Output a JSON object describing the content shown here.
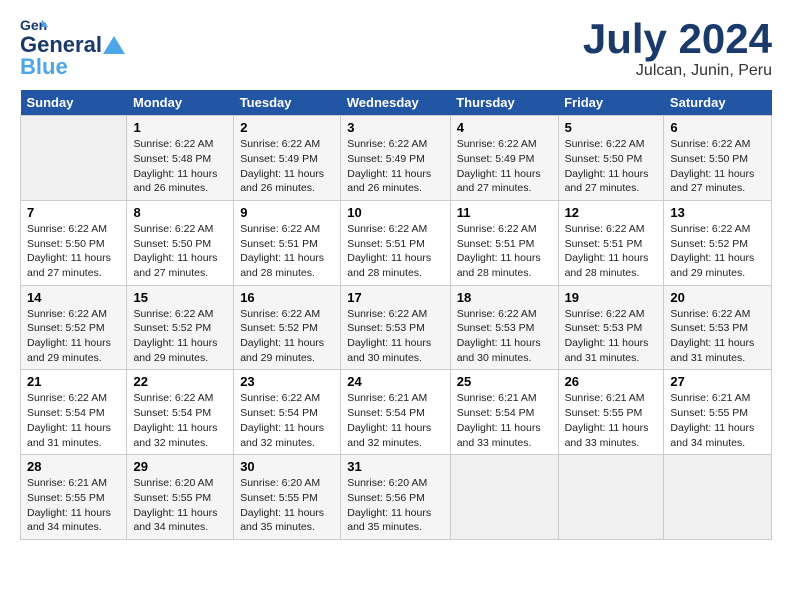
{
  "header": {
    "logo_general": "General",
    "logo_blue": "Blue",
    "title": "July 2024",
    "subtitle": "Julcan, Junin, Peru"
  },
  "calendar": {
    "days_of_week": [
      "Sunday",
      "Monday",
      "Tuesday",
      "Wednesday",
      "Thursday",
      "Friday",
      "Saturday"
    ],
    "weeks": [
      [
        {
          "day": "",
          "content": ""
        },
        {
          "day": "1",
          "content": "Sunrise: 6:22 AM\nSunset: 5:48 PM\nDaylight: 11 hours\nand 26 minutes."
        },
        {
          "day": "2",
          "content": "Sunrise: 6:22 AM\nSunset: 5:49 PM\nDaylight: 11 hours\nand 26 minutes."
        },
        {
          "day": "3",
          "content": "Sunrise: 6:22 AM\nSunset: 5:49 PM\nDaylight: 11 hours\nand 26 minutes."
        },
        {
          "day": "4",
          "content": "Sunrise: 6:22 AM\nSunset: 5:49 PM\nDaylight: 11 hours\nand 27 minutes."
        },
        {
          "day": "5",
          "content": "Sunrise: 6:22 AM\nSunset: 5:50 PM\nDaylight: 11 hours\nand 27 minutes."
        },
        {
          "day": "6",
          "content": "Sunrise: 6:22 AM\nSunset: 5:50 PM\nDaylight: 11 hours\nand 27 minutes."
        }
      ],
      [
        {
          "day": "7",
          "content": "Sunrise: 6:22 AM\nSunset: 5:50 PM\nDaylight: 11 hours\nand 27 minutes."
        },
        {
          "day": "8",
          "content": "Sunrise: 6:22 AM\nSunset: 5:50 PM\nDaylight: 11 hours\nand 27 minutes."
        },
        {
          "day": "9",
          "content": "Sunrise: 6:22 AM\nSunset: 5:51 PM\nDaylight: 11 hours\nand 28 minutes."
        },
        {
          "day": "10",
          "content": "Sunrise: 6:22 AM\nSunset: 5:51 PM\nDaylight: 11 hours\nand 28 minutes."
        },
        {
          "day": "11",
          "content": "Sunrise: 6:22 AM\nSunset: 5:51 PM\nDaylight: 11 hours\nand 28 minutes."
        },
        {
          "day": "12",
          "content": "Sunrise: 6:22 AM\nSunset: 5:51 PM\nDaylight: 11 hours\nand 28 minutes."
        },
        {
          "day": "13",
          "content": "Sunrise: 6:22 AM\nSunset: 5:52 PM\nDaylight: 11 hours\nand 29 minutes."
        }
      ],
      [
        {
          "day": "14",
          "content": "Sunrise: 6:22 AM\nSunset: 5:52 PM\nDaylight: 11 hours\nand 29 minutes."
        },
        {
          "day": "15",
          "content": "Sunrise: 6:22 AM\nSunset: 5:52 PM\nDaylight: 11 hours\nand 29 minutes."
        },
        {
          "day": "16",
          "content": "Sunrise: 6:22 AM\nSunset: 5:52 PM\nDaylight: 11 hours\nand 29 minutes."
        },
        {
          "day": "17",
          "content": "Sunrise: 6:22 AM\nSunset: 5:53 PM\nDaylight: 11 hours\nand 30 minutes."
        },
        {
          "day": "18",
          "content": "Sunrise: 6:22 AM\nSunset: 5:53 PM\nDaylight: 11 hours\nand 30 minutes."
        },
        {
          "day": "19",
          "content": "Sunrise: 6:22 AM\nSunset: 5:53 PM\nDaylight: 11 hours\nand 31 minutes."
        },
        {
          "day": "20",
          "content": "Sunrise: 6:22 AM\nSunset: 5:53 PM\nDaylight: 11 hours\nand 31 minutes."
        }
      ],
      [
        {
          "day": "21",
          "content": "Sunrise: 6:22 AM\nSunset: 5:54 PM\nDaylight: 11 hours\nand 31 minutes."
        },
        {
          "day": "22",
          "content": "Sunrise: 6:22 AM\nSunset: 5:54 PM\nDaylight: 11 hours\nand 32 minutes."
        },
        {
          "day": "23",
          "content": "Sunrise: 6:22 AM\nSunset: 5:54 PM\nDaylight: 11 hours\nand 32 minutes."
        },
        {
          "day": "24",
          "content": "Sunrise: 6:21 AM\nSunset: 5:54 PM\nDaylight: 11 hours\nand 32 minutes."
        },
        {
          "day": "25",
          "content": "Sunrise: 6:21 AM\nSunset: 5:54 PM\nDaylight: 11 hours\nand 33 minutes."
        },
        {
          "day": "26",
          "content": "Sunrise: 6:21 AM\nSunset: 5:55 PM\nDaylight: 11 hours\nand 33 minutes."
        },
        {
          "day": "27",
          "content": "Sunrise: 6:21 AM\nSunset: 5:55 PM\nDaylight: 11 hours\nand 34 minutes."
        }
      ],
      [
        {
          "day": "28",
          "content": "Sunrise: 6:21 AM\nSunset: 5:55 PM\nDaylight: 11 hours\nand 34 minutes."
        },
        {
          "day": "29",
          "content": "Sunrise: 6:20 AM\nSunset: 5:55 PM\nDaylight: 11 hours\nand 34 minutes."
        },
        {
          "day": "30",
          "content": "Sunrise: 6:20 AM\nSunset: 5:55 PM\nDaylight: 11 hours\nand 35 minutes."
        },
        {
          "day": "31",
          "content": "Sunrise: 6:20 AM\nSunset: 5:56 PM\nDaylight: 11 hours\nand 35 minutes."
        },
        {
          "day": "",
          "content": ""
        },
        {
          "day": "",
          "content": ""
        },
        {
          "day": "",
          "content": ""
        }
      ]
    ]
  }
}
